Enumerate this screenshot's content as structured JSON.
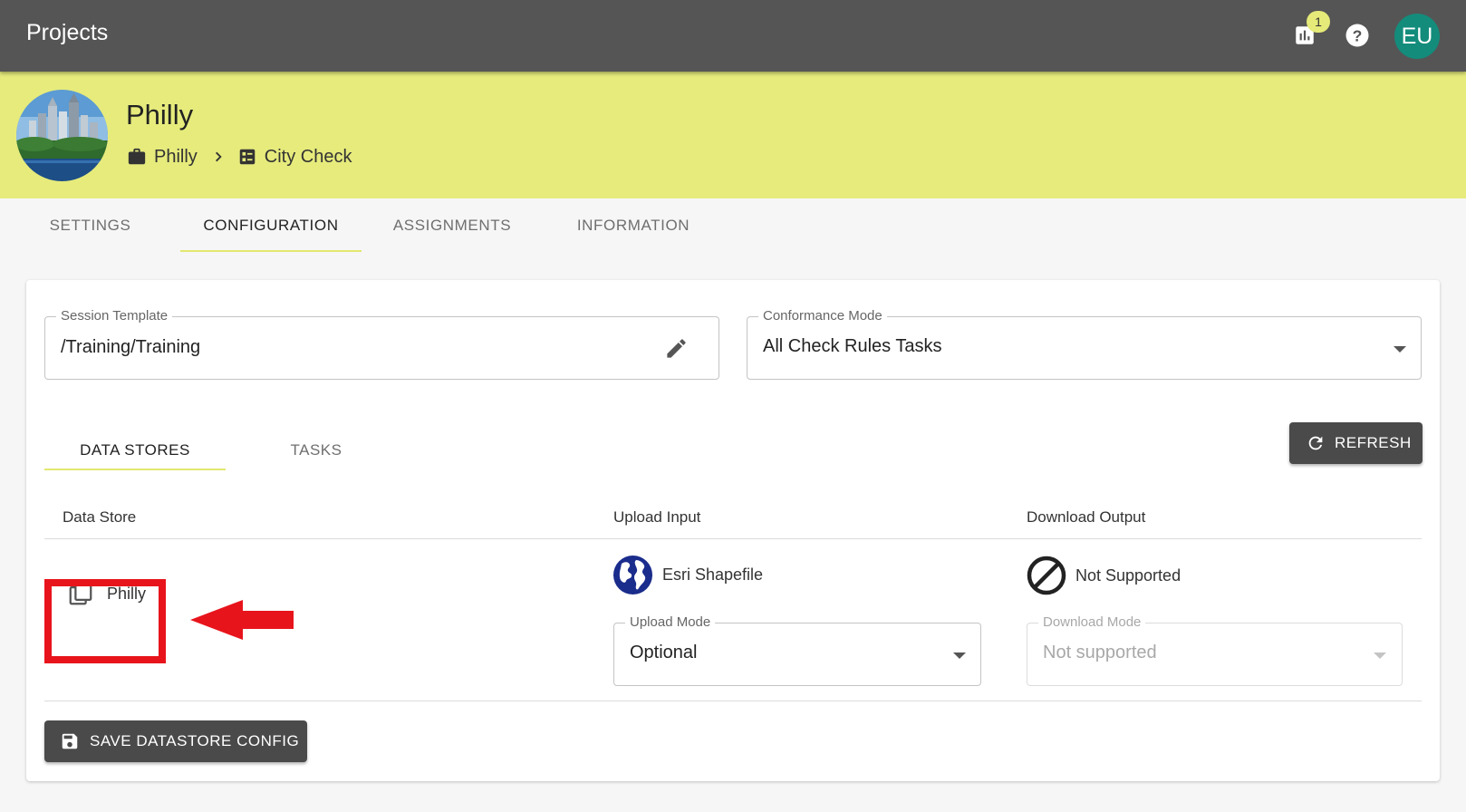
{
  "app": {
    "title": "Projects",
    "notifications_count": "1",
    "user_initials": "EU"
  },
  "project": {
    "name": "Philly",
    "breadcrumb": [
      "Philly",
      "City Check"
    ]
  },
  "tabs": [
    "SETTINGS",
    "CONFIGURATION",
    "ASSIGNMENTS",
    "INFORMATION"
  ],
  "active_tab": "CONFIGURATION",
  "config": {
    "session_template": {
      "label": "Session Template",
      "value": "/Training/Training"
    },
    "conformance_mode": {
      "label": "Conformance Mode",
      "value": "All Check Rules Tasks"
    },
    "subtabs": [
      "DATA STORES",
      "TASKS"
    ],
    "active_subtab": "DATA STORES",
    "refresh_label": "REFRESH",
    "table": {
      "columns": [
        "Data Store",
        "Upload Input",
        "Download Output"
      ],
      "rows": [
        {
          "data_store": "Philly",
          "upload_format": "Esri Shapefile",
          "upload_mode": {
            "label": "Upload Mode",
            "value": "Optional"
          },
          "download_format": "Not Supported",
          "download_mode": {
            "label": "Download Mode",
            "value": "Not supported"
          }
        }
      ]
    },
    "save_label": "SAVE DATASTORE CONFIG"
  },
  "colors": {
    "topbar": "#555555",
    "banner": "#e6eb7c",
    "accent": "#e3e86f",
    "avatar": "#138c7c",
    "highlight": "#e8141c"
  },
  "icons": [
    "bar-chart-icon",
    "help-icon",
    "briefcase-icon",
    "checklist-icon",
    "pencil-icon",
    "refresh-icon",
    "copy-icon",
    "globe-icon",
    "not-supported-icon",
    "save-icon"
  ]
}
